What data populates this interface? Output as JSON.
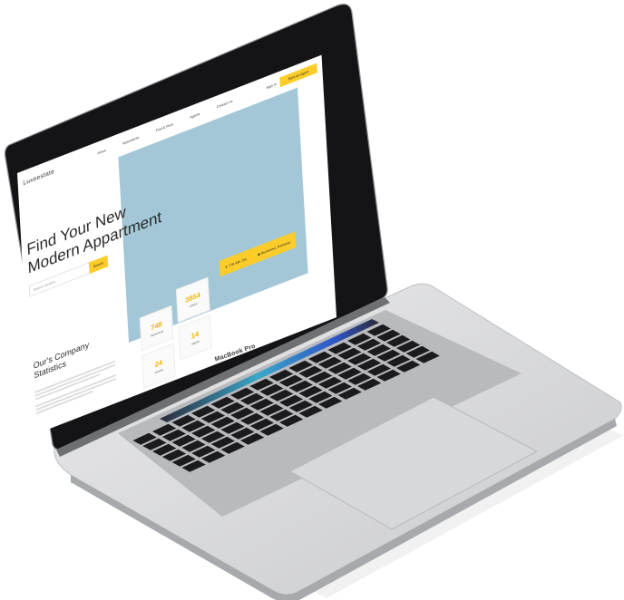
{
  "device": {
    "brand_label": "MacBook Pro"
  },
  "site": {
    "logo": "Luxeestate",
    "nav": [
      "About",
      "Apartments",
      "Find & Rent",
      "Agents",
      "Contact Us"
    ],
    "sign_in": "Sign In",
    "cta": "Rent an Agent"
  },
  "hero": {
    "title_line1": "Find Your New",
    "title_line2": "Modern Appartment",
    "search_placeholder": "Search location",
    "search_button": "Search",
    "phone": "778 435 755",
    "location": "Bucharest, Romania"
  },
  "stats": {
    "title_line1": "Our's Company",
    "title_line2": "Statistics",
    "items": [
      {
        "value": "748",
        "label": "Apartments"
      },
      {
        "value": "3854",
        "label": "Clients"
      },
      {
        "value": "24",
        "label": "Awards"
      },
      {
        "value": "14",
        "label": "Agents"
      }
    ]
  },
  "colors": {
    "accent": "#fccd2a",
    "hero_block": "#a3c7d6",
    "stat_number": "#f2b600"
  }
}
